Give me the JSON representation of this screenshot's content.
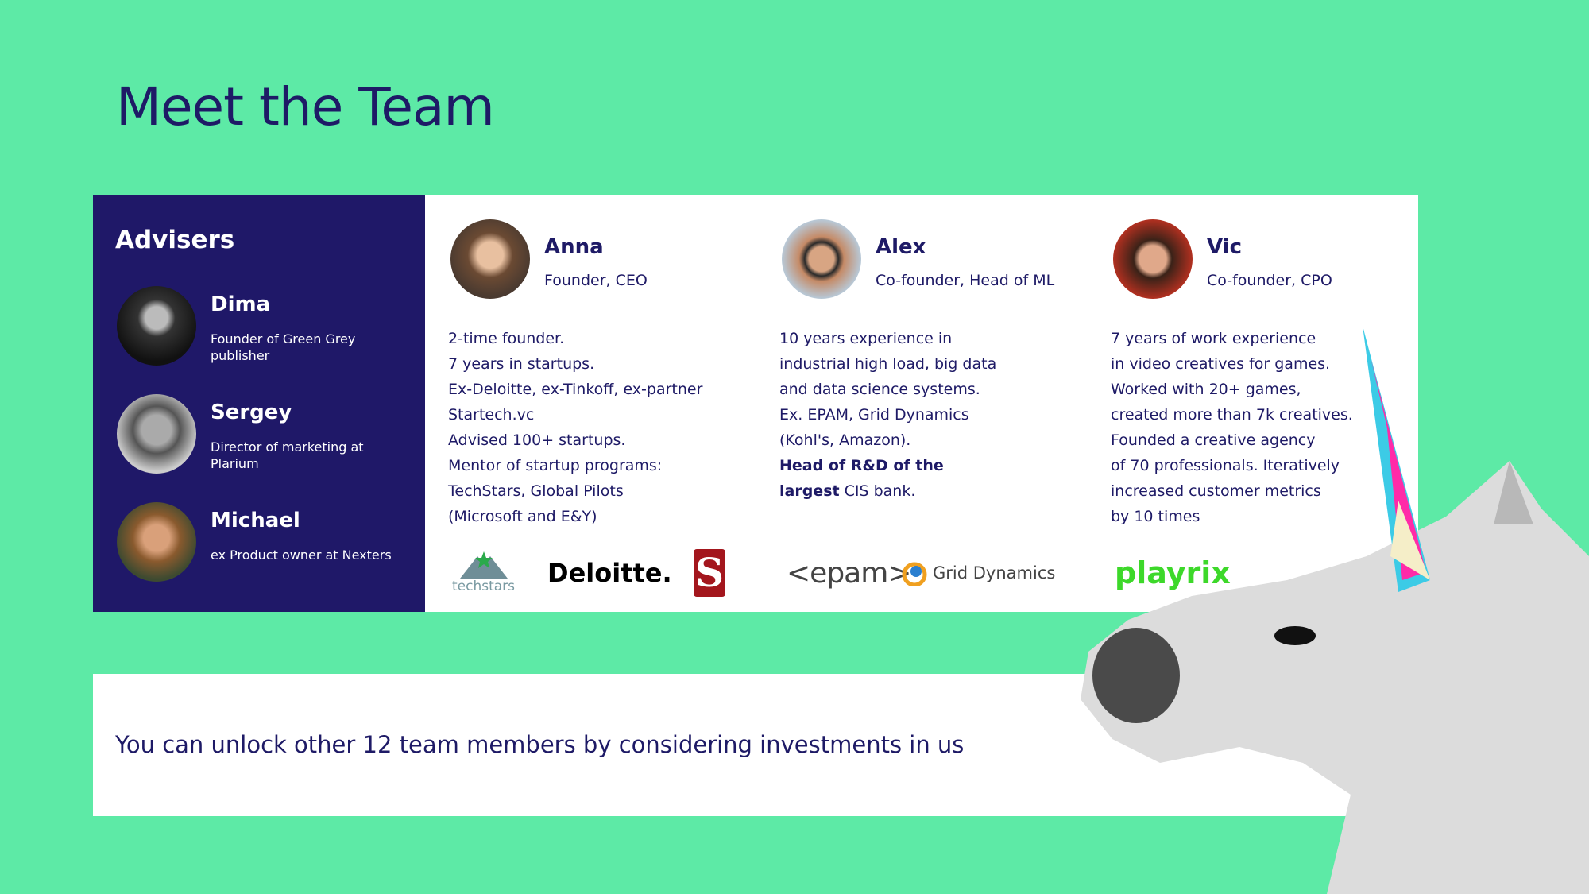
{
  "title": "Meet the Team",
  "advisers": {
    "heading": "Advisers",
    "people": [
      {
        "name": "Dima",
        "desc": "Founder of Green Grey publisher"
      },
      {
        "name": "Sergey",
        "desc": "Director of marketing at Plarium"
      },
      {
        "name": "Michael",
        "desc": "ex  Product owner at Nexters"
      }
    ]
  },
  "team": [
    {
      "name": "Anna",
      "role": "Founder, CEO",
      "lines": [
        "2-time founder.",
        "7 years in startups.",
        "Ex-Deloitte, ex-Tinkoff, ex-partner",
        "Startech.vc",
        "Advised 100+ startups.",
        "Mentor of startup programs:",
        "TechStars, Global Pilots",
        "(Microsoft and E&Y)"
      ],
      "logos": [
        "techstars",
        "Deloitte.",
        "S"
      ]
    },
    {
      "name": "Alex",
      "role": "Co-founder, Head of ML",
      "lines": [
        "10 years experience in",
        "industrial high load, big data",
        "and data science systems.",
        "Ex. EPAM, Grid Dynamics",
        "(Kohl's, Amazon)."
      ],
      "bold1": "Head of R&D of the",
      "bold2": "largest",
      "tail": " CIS bank.",
      "logos": [
        "<epam>",
        "Grid Dynamics"
      ]
    },
    {
      "name": "Vic",
      "role": "Co-founder, CPO",
      "lines": [
        "7 years of work experience",
        "in video creatives for games.",
        "Worked with 20+ games,",
        "created more than 7k creatives.",
        "Founded a creative agency",
        "of 70 professionals. Iteratively",
        "increased customer metrics",
        "by 10 times"
      ],
      "logos": [
        "playrix"
      ]
    }
  ],
  "bottom_text": "You can unlock other 12 team members by considering investments in us",
  "colors": {
    "background": "#5deaa6",
    "navy": "#1f1868",
    "playrix": "#3dd82a",
    "stanford": "#a3161d"
  }
}
